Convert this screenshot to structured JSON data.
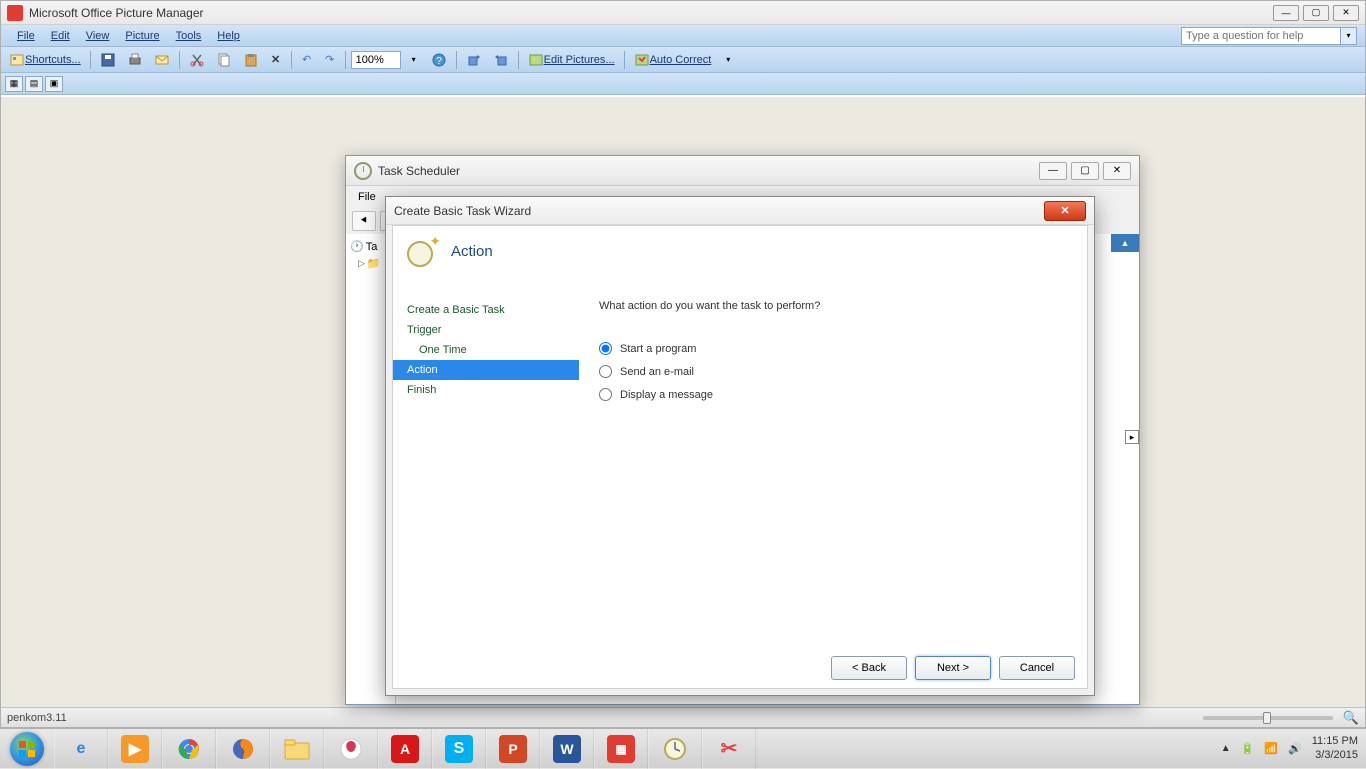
{
  "app": {
    "title": "Microsoft Office Picture Manager",
    "menus": [
      "File",
      "Edit",
      "View",
      "Picture",
      "Tools",
      "Help"
    ],
    "help_placeholder": "Type a question for help",
    "toolbar": {
      "shortcuts": "Shortcuts...",
      "zoom": "100%",
      "edit_pictures": "Edit Pictures...",
      "auto_correct": "Auto Correct"
    },
    "status_file": "penkom3.11"
  },
  "task_scheduler": {
    "title": "Task Scheduler",
    "menu_file": "File",
    "tree_root": "Ta"
  },
  "wizard": {
    "title": "Create Basic Task Wizard",
    "heading": "Action",
    "steps": {
      "create": "Create a Basic Task",
      "trigger": "Trigger",
      "one_time": "One Time",
      "action": "Action",
      "finish": "Finish"
    },
    "prompt": "What action do you want the task to perform?",
    "options": {
      "start_program": "Start a program",
      "send_email": "Send an e-mail",
      "display_message": "Display a message"
    },
    "buttons": {
      "back": "< Back",
      "next": "Next >",
      "cancel": "Cancel"
    }
  },
  "taskbar": {
    "time": "11:15 PM",
    "date": "3/3/2015"
  }
}
